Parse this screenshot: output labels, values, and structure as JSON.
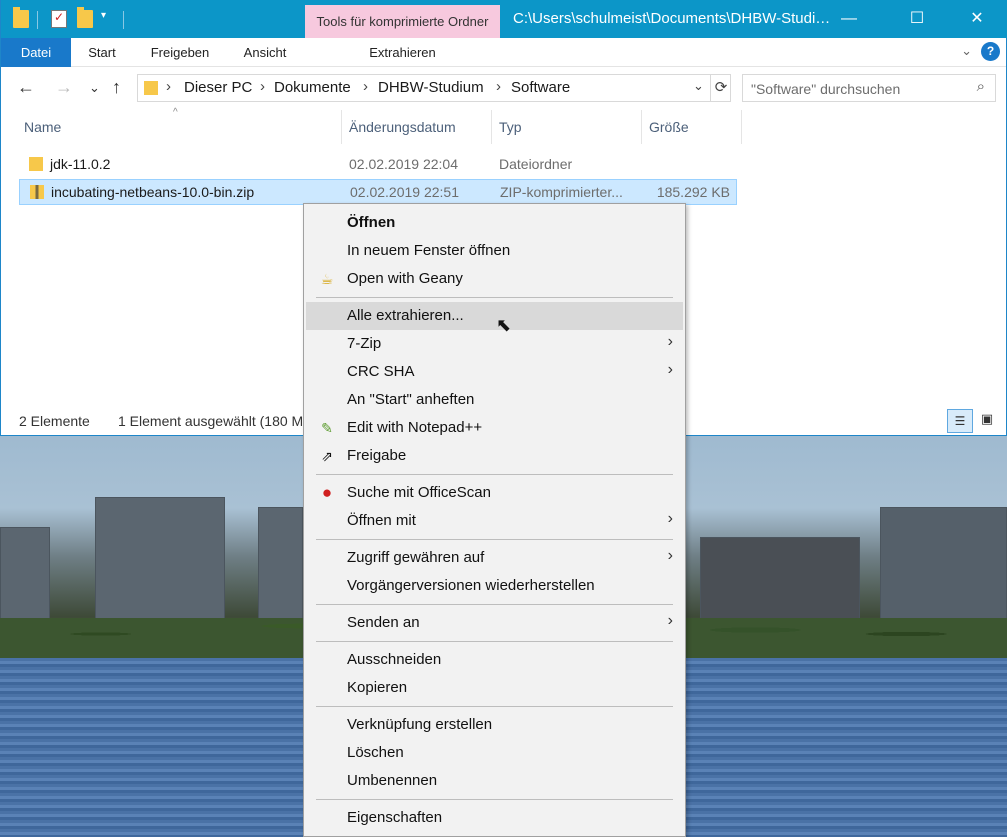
{
  "titlebar": {
    "context_tab": "Tools für komprimierte Ordner",
    "path": "C:\\Users\\schulmeist\\Documents\\DHBW-Studi…",
    "minimize": "—",
    "maximize": "☐",
    "close": "✕"
  },
  "ribbon": {
    "tabs": [
      "Datei",
      "Start",
      "Freigeben",
      "Ansicht"
    ],
    "context_tab": "Extrahieren",
    "expand": "⌄",
    "help": "?"
  },
  "navigation": {
    "back": "←",
    "forward": "→",
    "recent": "⌄",
    "up": "↑",
    "breadcrumb": [
      "Dieser PC",
      "Dokumente",
      "DHBW-Studium",
      "Software"
    ],
    "sep": "›",
    "dropdown": "⌄",
    "refresh": "⟳",
    "search_placeholder": "\"Software\" durchsuchen",
    "search_icon": "⌕"
  },
  "columns": {
    "name": "Name",
    "date": "Änderungsdatum",
    "type": "Typ",
    "size": "Größe",
    "sort_caret": "^"
  },
  "files": [
    {
      "name": "jdk-11.0.2",
      "date": "02.02.2019 22:04",
      "type": "Dateiordner",
      "size": "",
      "icon": "folder-icon"
    },
    {
      "name": "incubating-netbeans-10.0-bin.zip",
      "date": "02.02.2019 22:51",
      "type": "ZIP-komprimierter...",
      "size": "185.292 KB",
      "icon": "zip-icon"
    }
  ],
  "status": {
    "count": "2 Elemente",
    "selected": "1 Element ausgewählt (180 M"
  },
  "context_menu": {
    "items": [
      {
        "label": "Öffnen",
        "bold": true
      },
      {
        "label": "In neuem Fenster öffnen"
      },
      {
        "label": "Open with Geany",
        "icon": "geany-icon"
      },
      {
        "label": "Alle extrahieren...",
        "hover": true
      },
      {
        "label": "7-Zip",
        "submenu": true
      },
      {
        "label": "CRC SHA",
        "submenu": true
      },
      {
        "label": "An \"Start\" anheften"
      },
      {
        "label": "Edit with Notepad++",
        "icon": "notepadpp-icon"
      },
      {
        "label": "Freigabe",
        "icon": "share-icon"
      },
      {
        "label": "Suche mit OfficeScan",
        "icon": "officescan-icon"
      },
      {
        "label": "Öffnen mit",
        "submenu": true
      },
      {
        "label": "Zugriff gewähren auf",
        "submenu": true
      },
      {
        "label": "Vorgängerversionen wiederherstellen"
      },
      {
        "label": "Senden an",
        "submenu": true
      },
      {
        "label": "Ausschneiden"
      },
      {
        "label": "Kopieren"
      },
      {
        "label": "Verknüpfung erstellen"
      },
      {
        "label": "Löschen"
      },
      {
        "label": "Umbenennen"
      },
      {
        "label": "Eigenschaften"
      }
    ],
    "submenu_arrow": "›"
  },
  "colors": {
    "titlebar": "#0c96c8",
    "context_tab": "#f7c9de",
    "accent": "#1979ca",
    "selection": "#cce8ff"
  }
}
